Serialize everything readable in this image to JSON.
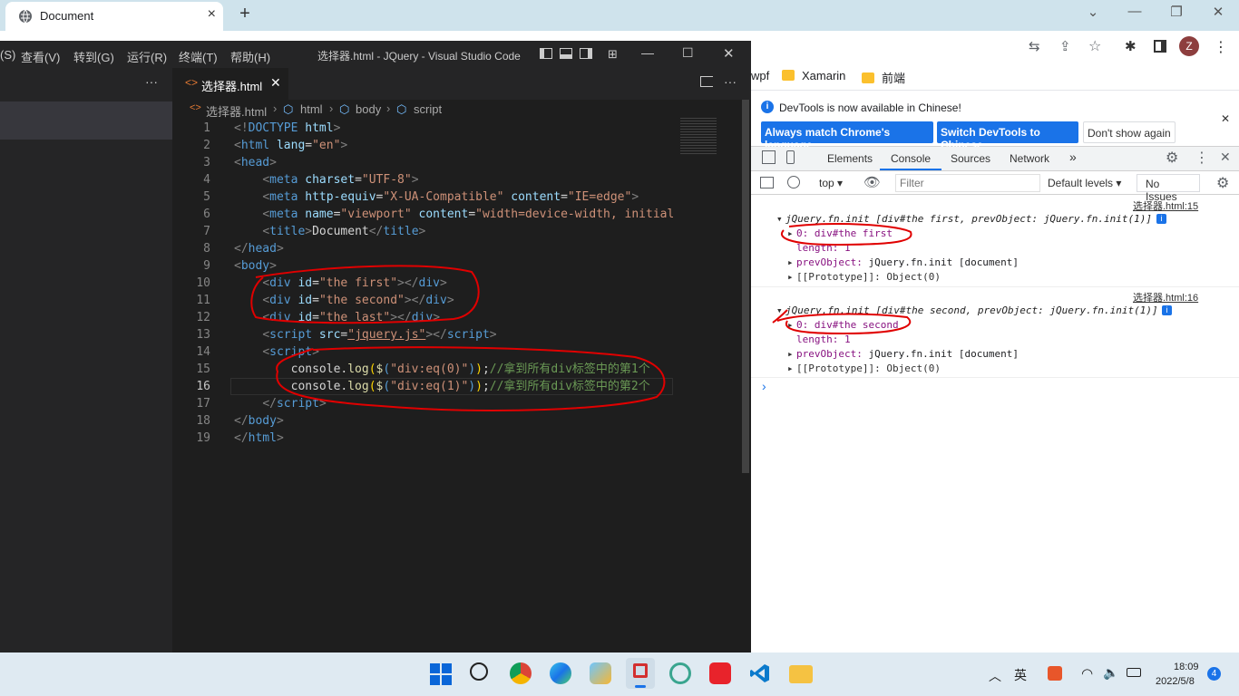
{
  "browser": {
    "tab_title": "Document",
    "new_tab": "+",
    "bookmarks": [
      "wpf",
      "Xamarin",
      "前端"
    ],
    "profile_initial": "Z"
  },
  "vscode": {
    "menu": [
      "(S)",
      "查看(V)",
      "转到(G)",
      "运行(R)",
      "终端(T)",
      "帮助(H)"
    ],
    "title": "选择器.html - JQuery - Visual Studio Code",
    "file_tab": "选择器.html",
    "breadcrumb": [
      "选择器.html",
      "html",
      "body",
      "script"
    ],
    "line_numbers": [
      "1",
      "2",
      "3",
      "4",
      "5",
      "6",
      "7",
      "8",
      "9",
      "10",
      "11",
      "12",
      "13",
      "14",
      "15",
      "16",
      "17",
      "18",
      "19"
    ],
    "code": [
      [
        [
          "k",
          "<!"
        ],
        [
          "t",
          "DOCTYPE"
        ],
        [
          "a",
          " html"
        ],
        [
          "k",
          ">"
        ]
      ],
      [
        [
          "k",
          "<"
        ],
        [
          "t",
          "html"
        ],
        [
          "a",
          " lang"
        ],
        [
          "d",
          "="
        ],
        [
          "s",
          "\"en\""
        ],
        [
          "k",
          ">"
        ]
      ],
      [
        [
          "k",
          "<"
        ],
        [
          "t",
          "head"
        ],
        [
          "k",
          ">"
        ]
      ],
      [
        [
          "d",
          "    "
        ],
        [
          "k",
          "<"
        ],
        [
          "t",
          "meta"
        ],
        [
          "a",
          " charset"
        ],
        [
          "d",
          "="
        ],
        [
          "s",
          "\"UTF-8\""
        ],
        [
          "k",
          ">"
        ]
      ],
      [
        [
          "d",
          "    "
        ],
        [
          "k",
          "<"
        ],
        [
          "t",
          "meta"
        ],
        [
          "a",
          " http-equiv"
        ],
        [
          "d",
          "="
        ],
        [
          "s",
          "\"X-UA-Compatible\""
        ],
        [
          "a",
          " content"
        ],
        [
          "d",
          "="
        ],
        [
          "s",
          "\"IE=edge\""
        ],
        [
          "k",
          ">"
        ]
      ],
      [
        [
          "d",
          "    "
        ],
        [
          "k",
          "<"
        ],
        [
          "t",
          "meta"
        ],
        [
          "a",
          " name"
        ],
        [
          "d",
          "="
        ],
        [
          "s",
          "\"viewport\""
        ],
        [
          "a",
          " content"
        ],
        [
          "d",
          "="
        ],
        [
          "s",
          "\"width=device-width, initial-"
        ]
      ],
      [
        [
          "d",
          "    "
        ],
        [
          "k",
          "<"
        ],
        [
          "t",
          "title"
        ],
        [
          "k",
          ">"
        ],
        [
          "d",
          "Document"
        ],
        [
          "k",
          "</"
        ],
        [
          "t",
          "title"
        ],
        [
          "k",
          ">"
        ]
      ],
      [
        [
          "k",
          "</"
        ],
        [
          "t",
          "head"
        ],
        [
          "k",
          ">"
        ]
      ],
      [
        [
          "k",
          "<"
        ],
        [
          "t",
          "body"
        ],
        [
          "k",
          ">"
        ]
      ],
      [
        [
          "d",
          "    "
        ],
        [
          "k",
          "<"
        ],
        [
          "t",
          "div"
        ],
        [
          "a",
          " id"
        ],
        [
          "d",
          "="
        ],
        [
          "s",
          "\"the first\""
        ],
        [
          "k",
          "></"
        ],
        [
          "t",
          "div"
        ],
        [
          "k",
          ">"
        ]
      ],
      [
        [
          "d",
          "    "
        ],
        [
          "k",
          "<"
        ],
        [
          "t",
          "div"
        ],
        [
          "a",
          " id"
        ],
        [
          "d",
          "="
        ],
        [
          "s",
          "\"the second\""
        ],
        [
          "k",
          "></"
        ],
        [
          "t",
          "div"
        ],
        [
          "k",
          ">"
        ]
      ],
      [
        [
          "d",
          "    "
        ],
        [
          "k",
          "<"
        ],
        [
          "t",
          "div"
        ],
        [
          "a",
          " id"
        ],
        [
          "d",
          "="
        ],
        [
          "s",
          "\"the last\""
        ],
        [
          "k",
          "></"
        ],
        [
          "t",
          "div"
        ],
        [
          "k",
          ">"
        ]
      ],
      [
        [
          "d",
          "    "
        ],
        [
          "k",
          "<"
        ],
        [
          "t",
          "script"
        ],
        [
          "a",
          " src"
        ],
        [
          "d",
          "="
        ],
        [
          "s",
          "\"jquery.js\""
        ],
        [
          "k",
          "></"
        ],
        [
          "t",
          "script"
        ],
        [
          "k",
          ">"
        ]
      ],
      [
        [
          "d",
          "    "
        ],
        [
          "k",
          "<"
        ],
        [
          "t",
          "script"
        ],
        [
          "k",
          ">"
        ]
      ],
      [
        [
          "d",
          "        console."
        ],
        [
          "f",
          "log"
        ],
        [
          "y",
          "("
        ],
        [
          "f",
          "$"
        ],
        [
          "t",
          "("
        ],
        [
          "s",
          "\"div:eq(0)\""
        ],
        [
          "t",
          ")"
        ],
        [
          "y",
          ")"
        ],
        [
          "d",
          ";"
        ],
        [
          "c",
          "//拿到所有div标签中的第1个"
        ]
      ],
      [
        [
          "d",
          "        console."
        ],
        [
          "f",
          "log"
        ],
        [
          "y",
          "("
        ],
        [
          "f",
          "$"
        ],
        [
          "t",
          "("
        ],
        [
          "s",
          "\"div:eq(1)\""
        ],
        [
          "t",
          ")"
        ],
        [
          "y",
          ")"
        ],
        [
          "d",
          ";"
        ],
        [
          "c",
          "//拿到所有div标签中的第2个"
        ]
      ],
      [
        [
          "d",
          "    "
        ],
        [
          "k",
          "</"
        ],
        [
          "t",
          "script"
        ],
        [
          "k",
          ">"
        ]
      ],
      [
        [
          "k",
          "</"
        ],
        [
          "t",
          "body"
        ],
        [
          "k",
          ">"
        ]
      ],
      [
        [
          "k",
          "</"
        ],
        [
          "t",
          "html"
        ],
        [
          "k",
          ">"
        ]
      ]
    ]
  },
  "devtools": {
    "info": "DevTools is now available in Chinese!",
    "btn_match": "Always match Chrome's language",
    "btn_switch": "Switch DevTools to Chinese",
    "btn_dont": "Don't show again",
    "tabs": [
      "Elements",
      "Console",
      "Sources",
      "Network",
      "»"
    ],
    "context": "top ▾",
    "filter_placeholder": "Filter",
    "levels": "Default levels ▾",
    "issues": "No Issues",
    "logs": [
      {
        "source": "选择器.html:15",
        "head": "jQuery.fn.init [div#the first, prevObject: jQuery.fn.init(1)]",
        "item0": "0: div#the first",
        "length": "length: 1",
        "prev_key": "prevObject:",
        "prev_val": " jQuery.fn.init [document]",
        "proto": "[[Prototype]]: Object(0)"
      },
      {
        "source": "选择器.html:16",
        "head": "jQuery.fn.init [div#the second, prevObject: jQuery.fn.init(1)]",
        "item0": "0: div#the second",
        "length": "length: 1",
        "prev_key": "prevObject:",
        "prev_val": " jQuery.fn.init [document]",
        "proto": "[[Prototype]]: Object(0)"
      }
    ],
    "prompt": "›"
  },
  "taskbar": {
    "time": "18:09",
    "date": "2022/5/8",
    "notification_count": "4",
    "app_icons": [
      "start-icon",
      "search-icon",
      "chrome-icon",
      "edge-icon",
      "photos-icon",
      "snipping-icon",
      "app-icon",
      "youdao-icon",
      "vscode-icon",
      "file-explorer-icon"
    ],
    "sougou_label": "英"
  },
  "colors": {
    "accent": "#1a73e8",
    "annotation": "#e00000",
    "vscode_bg": "#1e1e1e"
  }
}
